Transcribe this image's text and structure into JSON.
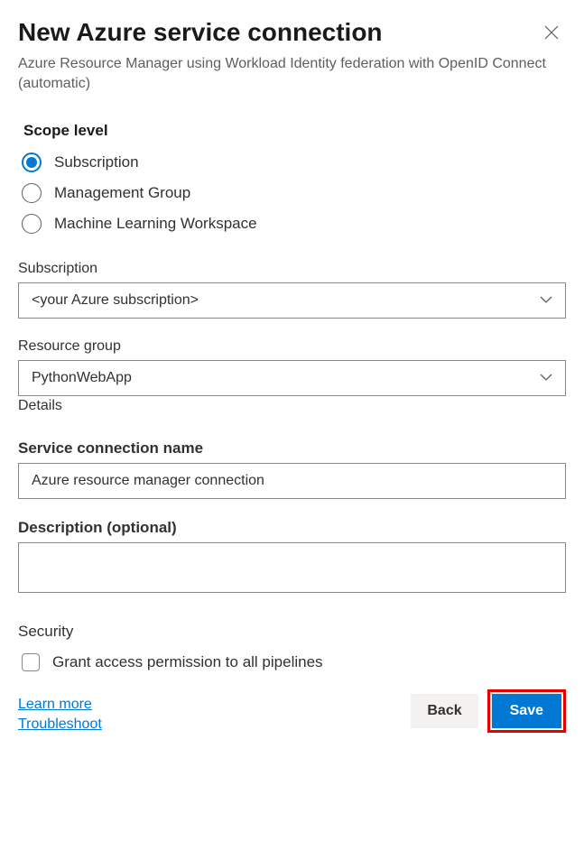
{
  "header": {
    "title": "New Azure service connection",
    "subtitle": "Azure Resource Manager using Workload Identity federation with OpenID Connect (automatic)"
  },
  "scope": {
    "label": "Scope level",
    "options": {
      "subscription": "Subscription",
      "management_group": "Management Group",
      "ml_workspace": "Machine Learning Workspace"
    }
  },
  "subscription": {
    "label": "Subscription",
    "value": "<your Azure subscription>"
  },
  "resource_group": {
    "label": "Resource group",
    "value": "PythonWebApp",
    "hint": "Details"
  },
  "connection_name": {
    "label": "Service connection name",
    "value": "Azure resource manager connection"
  },
  "description": {
    "label": "Description (optional)",
    "value": ""
  },
  "security": {
    "heading": "Security",
    "checkbox_label": "Grant access permission to all pipelines"
  },
  "links": {
    "learn_more": "Learn more",
    "troubleshoot": "Troubleshoot"
  },
  "buttons": {
    "back": "Back",
    "save": "Save"
  }
}
